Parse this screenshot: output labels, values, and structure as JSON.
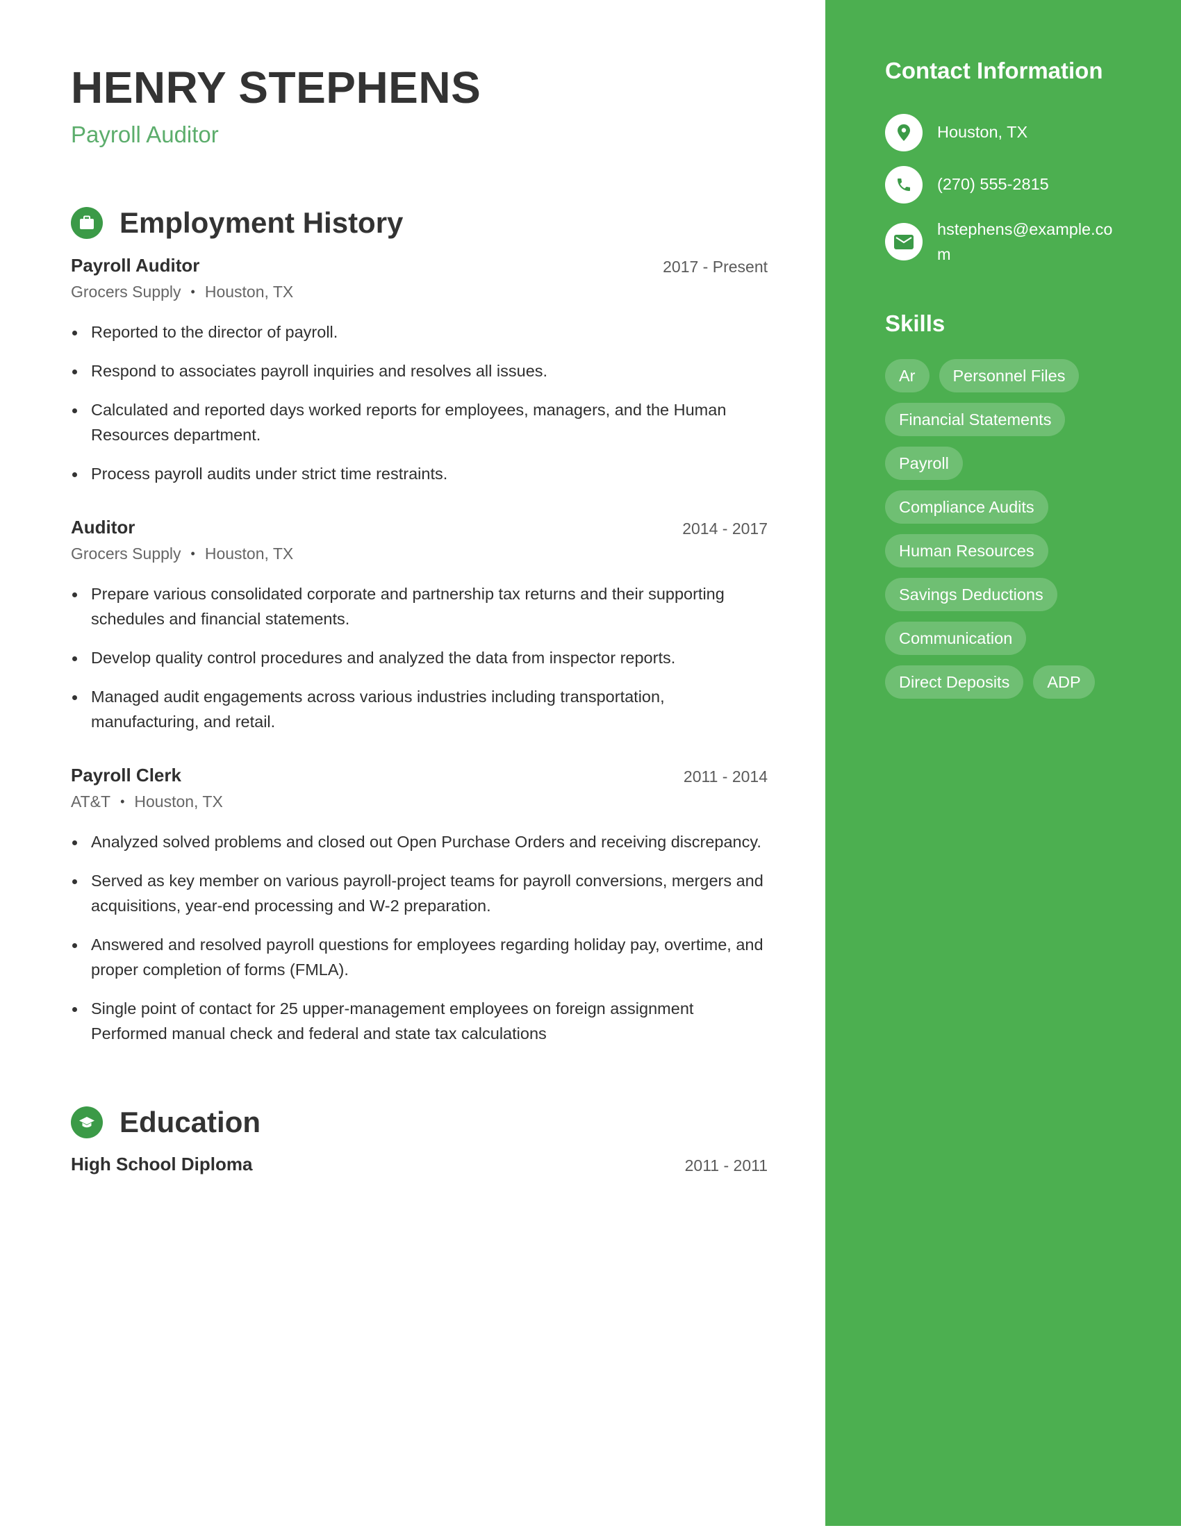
{
  "header": {
    "name": "HENRY STEPHENS",
    "title": "Payroll Auditor"
  },
  "employment": {
    "heading": "Employment History",
    "icon": "briefcase-icon",
    "jobs": [
      {
        "title": "Payroll Auditor",
        "dates": "2017 - Present",
        "company": "Grocers Supply",
        "location": "Houston, TX",
        "bullets": [
          "Reported to the director of payroll.",
          "Respond to associates payroll inquiries and resolves all issues.",
          "Calculated and reported days worked reports for employees, managers, and the Human Resources department.",
          "Process payroll audits under strict time restraints."
        ]
      },
      {
        "title": "Auditor",
        "dates": "2014 - 2017",
        "company": "Grocers Supply",
        "location": "Houston, TX",
        "bullets": [
          "Prepare various consolidated corporate and partnership tax returns and their supporting schedules and financial statements.",
          "Develop quality control procedures and analyzed the data from inspector reports.",
          "Managed audit engagements across various industries including transportation, manufacturing, and retail."
        ]
      },
      {
        "title": "Payroll Clerk",
        "dates": "2011 - 2014",
        "company": "AT&T",
        "location": "Houston, TX",
        "bullets": [
          "Analyzed solved problems and closed out Open Purchase Orders and receiving discrepancy.",
          "Served as key member on various payroll-project teams for payroll conversions, mergers and acquisitions, year-end processing and W-2 preparation.",
          "Answered and resolved payroll questions for employees regarding holiday pay, overtime, and proper completion of forms (FMLA).",
          "Single point of contact for 25 upper-management employees on foreign assignment Performed manual check and federal and state tax calculations"
        ]
      }
    ]
  },
  "education": {
    "heading": "Education",
    "icon": "graduation-cap-icon",
    "entries": [
      {
        "degree": "High School Diploma",
        "dates": "2011 - 2011"
      }
    ]
  },
  "sidebar": {
    "contact_heading": "Contact Information",
    "contacts": [
      {
        "icon": "location-pin-icon",
        "value": "Houston, TX"
      },
      {
        "icon": "phone-icon",
        "value": "(270) 555-2815"
      },
      {
        "icon": "email-icon",
        "value": "hstephens@example.com"
      }
    ],
    "skills_heading": "Skills",
    "skills": [
      "Ar",
      "Personnel Files",
      "Financial Statements",
      "Payroll",
      "Compliance Audits",
      "Human Resources",
      "Savings Deductions",
      "Communication",
      "Direct Deposits",
      "ADP"
    ]
  },
  "colors": {
    "accent": "#4caf50",
    "icon_green": "#3b9a47",
    "title_green": "#5cad6c",
    "text": "#2f2f2f"
  }
}
